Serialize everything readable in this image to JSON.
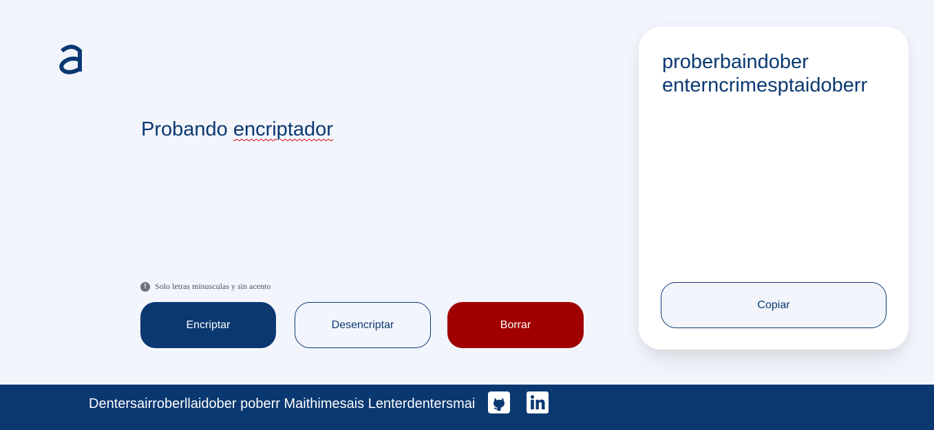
{
  "input": {
    "text_plain": "Probando ",
    "text_misspelled": "encriptador"
  },
  "hint": {
    "icon": "info-icon",
    "icon_glyph": "!",
    "text": "Solo letras minusculas y sin acento"
  },
  "buttons": {
    "encrypt": "Encriptar",
    "decrypt": "Desencriptar",
    "clear": "Borrar",
    "copy": "Copiar"
  },
  "result": {
    "line1": "proberbaindober",
    "line2": "enterncrimesptaidoberr"
  },
  "footer": {
    "text": "Dentersairroberllaidober poberr Maithimesais Lenterdentersmai",
    "icons": [
      "github-icon",
      "linkedin-icon"
    ]
  },
  "colors": {
    "primary": "#0a3871",
    "danger": "#a00000",
    "background": "#f3f5fc",
    "card": "#ffffff"
  }
}
